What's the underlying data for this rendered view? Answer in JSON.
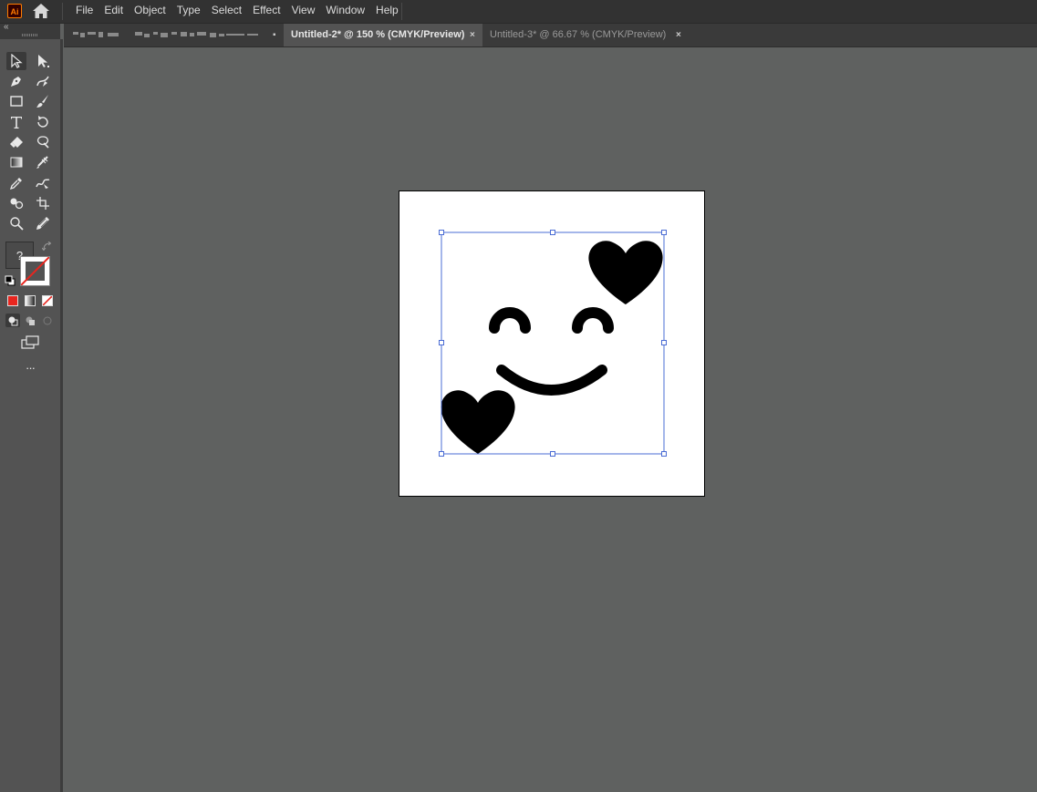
{
  "app": {
    "logo_text": "Ai"
  },
  "menu": {
    "items": [
      "File",
      "Edit",
      "Object",
      "Type",
      "Select",
      "Effect",
      "View",
      "Window",
      "Help"
    ]
  },
  "panel": {
    "collapse_glyph": "«"
  },
  "tabs": [
    {
      "label": "",
      "blurred": true,
      "active": false,
      "close_glyph": "▪"
    },
    {
      "label": "Untitled-2* @ 150 % (CMYK/Preview)",
      "active": true,
      "close_glyph": "×"
    },
    {
      "label": "Untitled-3* @ 66.67 % (CMYK/Preview)",
      "active": false,
      "close_glyph": "×"
    }
  ],
  "tools": {
    "fill_unknown_glyph": "?",
    "more_glyph": "···"
  },
  "colors": {
    "selection": "#4a6cd4",
    "artwork": "#000000",
    "canvas_bg": "#5f6160",
    "toolbar_bg": "#535353",
    "swatch_red": "#e8261f"
  },
  "artwork": {
    "description_icons": [
      "heart-icon",
      "heart-icon",
      "smile-eye-icon",
      "smile-eye-icon",
      "smile-mouth-icon"
    ]
  }
}
